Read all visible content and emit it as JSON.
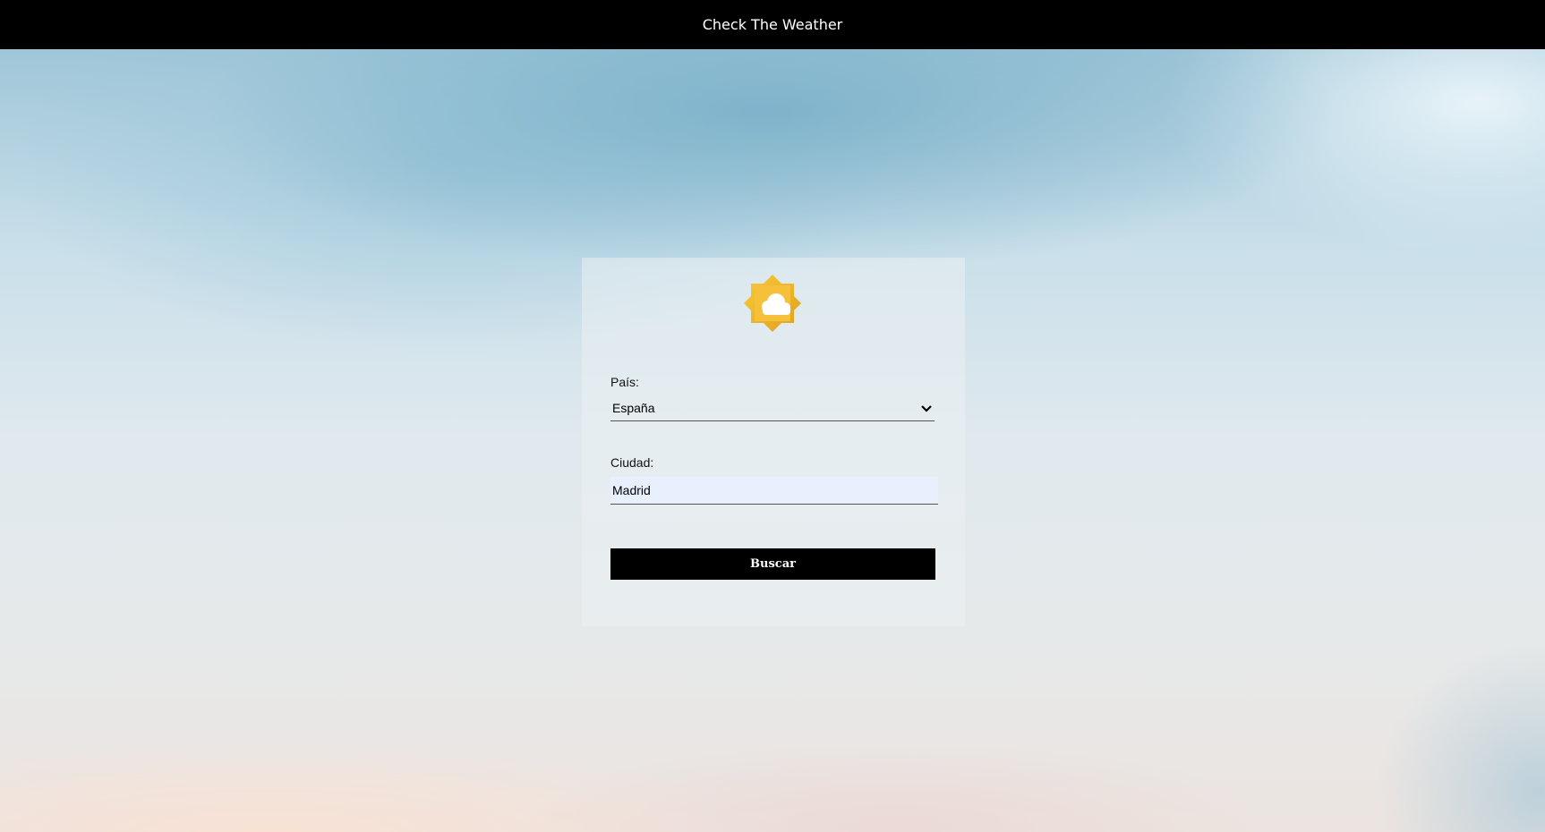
{
  "header": {
    "title": "Check The Weather"
  },
  "logo": {
    "icon": "sun-cloud-icon"
  },
  "form": {
    "country": {
      "label": "País:",
      "selected": "España"
    },
    "city": {
      "label": "Ciudad:",
      "value": "Madrid"
    },
    "submit_label": "Buscar"
  },
  "colors": {
    "header_bg": "#000000",
    "button_bg": "#000000",
    "autofill_bg": "#e8f0fe",
    "sun": "#f3b82c"
  }
}
